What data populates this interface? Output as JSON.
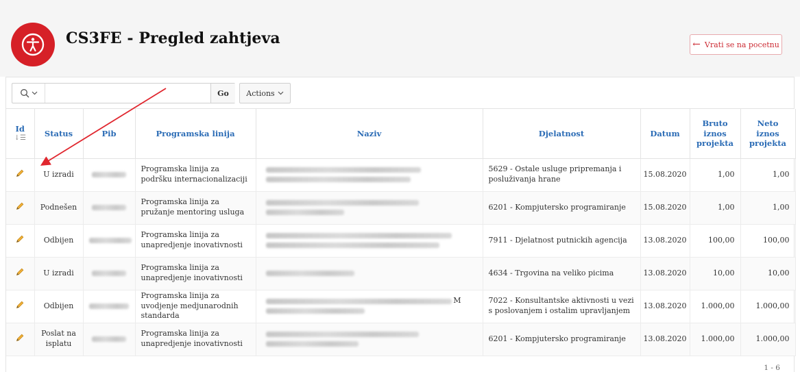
{
  "header": {
    "title": "CS3FE - Pregled zahtjeva",
    "back_label": "Vrati se na pocetnu",
    "logo_icon": "accessibility-icon",
    "logo_color": "#d62027"
  },
  "toolbar": {
    "search_value": "",
    "go_label": "Go",
    "actions_label": "Actions"
  },
  "table": {
    "columns": [
      "Id",
      "Status",
      "Pib",
      "Programska linija",
      "Naziv",
      "Djelatnost",
      "Datum",
      "Bruto iznos projekta",
      "Neto iznos projekta"
    ],
    "rows": [
      {
        "status": "U izradi",
        "programska_linija": "Programska linija za podršku internacionalizaciji",
        "djelatnost": "5629 - Ostale usluge pripremanja i posluživanja hrane",
        "datum": "15.08.2020",
        "bruto": "1,00",
        "neto": "1,00"
      },
      {
        "status": "Podnešen",
        "programska_linija": "Programska linija za pružanje mentoring usluga",
        "djelatnost": "6201 - Kompjutersko programiranje",
        "datum": "15.08.2020",
        "bruto": "1,00",
        "neto": "1,00"
      },
      {
        "status": "Odbijen",
        "programska_linija": "Programska linija za unapredjenje inovativnosti",
        "djelatnost": "7911 - Djelatnost putnickih agencija",
        "datum": "13.08.2020",
        "bruto": "100,00",
        "neto": "100,00"
      },
      {
        "status": "U izradi",
        "programska_linija": "Programska linija za unapredjenje inovativnosti",
        "djelatnost": "4634 - Trgovina na veliko picima",
        "datum": "13.08.2020",
        "bruto": "10,00",
        "neto": "10,00"
      },
      {
        "status": "Odbijen",
        "programska_linija": "Programska linija za uvodjenje medjunarodnih standarda",
        "naziv_suffix": "M",
        "djelatnost": "7022 - Konsultantske aktivnosti u vezi s poslovanjem i ostalim upravljanjem",
        "datum": "13.08.2020",
        "bruto": "1.000,00",
        "neto": "1.000,00"
      },
      {
        "status": "Poslat na isplatu",
        "programska_linija": "Programska linija za unapredjenje inovativnosti",
        "djelatnost": "6201 - Kompjutersko programiranje",
        "datum": "13.08.2020",
        "bruto": "1.000,00",
        "neto": "1.000,00"
      }
    ]
  },
  "pagination": "1 - 6",
  "colors": {
    "accent": "#d62027",
    "header_link": "#2a6bb5",
    "annotation_arrow": "#e0262e"
  }
}
